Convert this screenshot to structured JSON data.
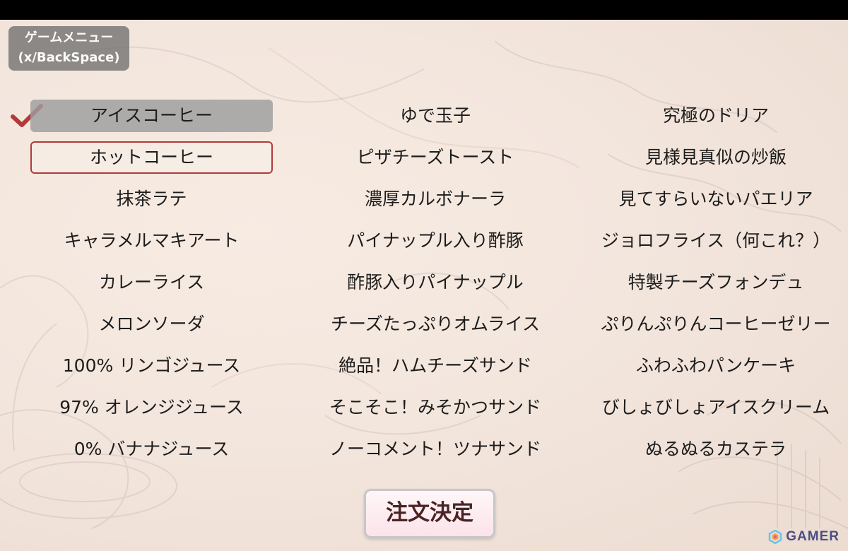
{
  "game_menu": {
    "line1": "ゲームメニュー",
    "line2": "(x/BackSpace)"
  },
  "columns": [
    {
      "items": [
        "アイスコーヒー",
        "ホットコーヒー",
        "抹茶ラテ",
        "キャラメルマキアート",
        "カレーライス",
        "メロンソーダ",
        "100% リンゴジュース",
        "97% オレンジジュース",
        "0% バナナジュース"
      ]
    },
    {
      "items": [
        "ゆで玉子",
        "ピザチーズトースト",
        "濃厚カルボナーラ",
        "パイナップル入り酢豚",
        "酢豚入りパイナップル",
        "チーズたっぷりオムライス",
        "絶品！ハムチーズサンド",
        "そこそこ！みそかつサンド",
        "ノーコメント！ツナサンド"
      ]
    },
    {
      "items": [
        "究極のドリア",
        "見様見真似の炒飯",
        "見てすらいないパエリア",
        "ジョロフライス（何これ？）",
        "特製チーズフォンデュ",
        "ぷりんぷりんコーヒーゼリー",
        "ふわふわパンケーキ",
        "びしょびしょアイスクリーム",
        "ぬるぬるカステラ"
      ]
    }
  ],
  "selected_item": "アイスコーヒー",
  "cursor_item": "ホットコーヒー",
  "order_button": {
    "label": "注文決定"
  },
  "watermark": {
    "text": "GAMER"
  },
  "colors": {
    "background": "#f3e6dd",
    "selected_fill": "#9e9e9e",
    "cursor_border": "#b23a3a",
    "checkmark": "#b23a3a",
    "menu_button": "#6e6e6e"
  },
  "icons": {
    "check": "checkmark-icon",
    "logo": "gamer-logo-icon"
  }
}
